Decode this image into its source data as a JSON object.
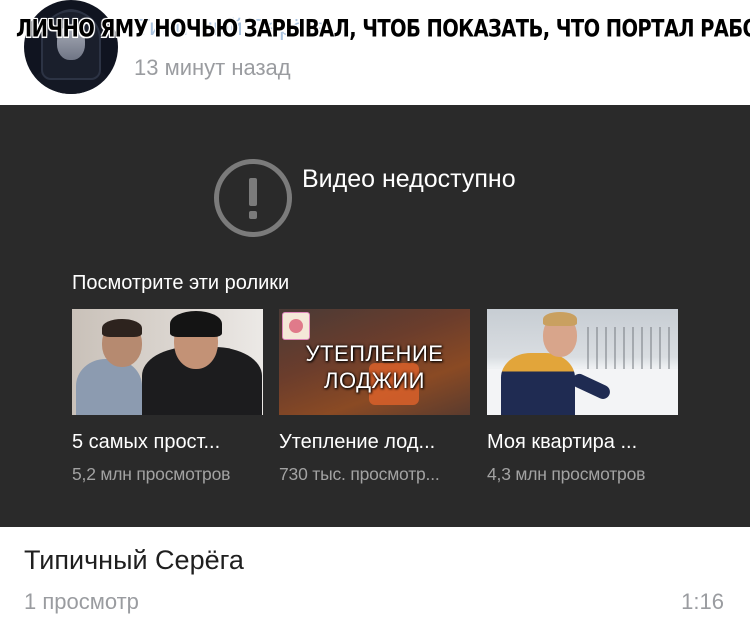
{
  "post": {
    "author_name": "Типичный Серёга",
    "caption": "ЛИЧНО ЯМУ НОЧЬЮ ЗАРЫВАЛ, ЧТОБ ПОКАЗАТЬ, ЧТО ПОРТАЛ РАБОТАЕТ",
    "time": "13 минут назад"
  },
  "player": {
    "unavailable_text": "Видео недоступно",
    "suggestions_title": "Посмотрите эти ролики",
    "suggestions": [
      {
        "title": "5 самых прост...",
        "views": "5,2 млн просмотров"
      },
      {
        "title": "Утепление лод...",
        "views": "730 тыс. просмотр...",
        "thumb_text_line1": "УТЕПЛЕНИЕ",
        "thumb_text_line2": "ЛОДЖИИ"
      },
      {
        "title": "Моя квартира ...",
        "views": "4,3 млн просмотров"
      }
    ]
  },
  "video": {
    "name": "Типичный Серёга",
    "views": "1 просмотр",
    "duration": "1:16"
  },
  "colors": {
    "panel_bg": "#2a2a2a",
    "meta_gray": "#9a9ca0",
    "link_blue": "#a9c2de"
  }
}
